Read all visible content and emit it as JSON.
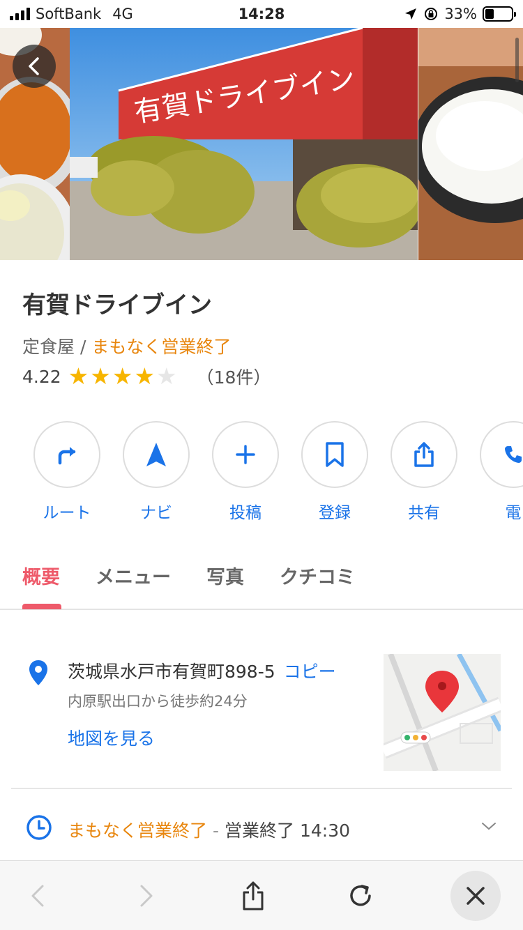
{
  "status_bar": {
    "carrier": "SoftBank",
    "network": "4G",
    "time": "14:28",
    "battery": "33%"
  },
  "place": {
    "name": "有賀ドライブイン",
    "category": "定食屋",
    "separator": "/",
    "open_status": "まもなく営業終了",
    "rating": "4.22",
    "rating_stars": 4,
    "review_count": "（18件）"
  },
  "photo_sign_text": "有賀ドライブイン",
  "actions": [
    {
      "label": "ルート",
      "icon": "route-arrow-icon"
    },
    {
      "label": "ナビ",
      "icon": "navigation-icon"
    },
    {
      "label": "投稿",
      "icon": "plus-icon"
    },
    {
      "label": "登録",
      "icon": "bookmark-icon"
    },
    {
      "label": "共有",
      "icon": "share-icon"
    },
    {
      "label": "電",
      "icon": "phone-icon"
    }
  ],
  "tabs": [
    {
      "label": "概要",
      "active": true
    },
    {
      "label": "メニュー",
      "active": false
    },
    {
      "label": "写真",
      "active": false
    },
    {
      "label": "クチコミ",
      "active": false
    }
  ],
  "address": {
    "text": "茨城県水戸市有賀町898-5",
    "copy_label": "コピー",
    "station": "内原駅出口から徒歩約24分",
    "map_link": "地図を見る"
  },
  "hours": {
    "status": "まもなく営業終了",
    "separator": "-",
    "detail": "営業終了 14:30"
  },
  "colors": {
    "accent_blue": "#1a73e8",
    "accent_red": "#ee5a6a",
    "status_orange": "#e8860e",
    "star": "#f7b500"
  }
}
